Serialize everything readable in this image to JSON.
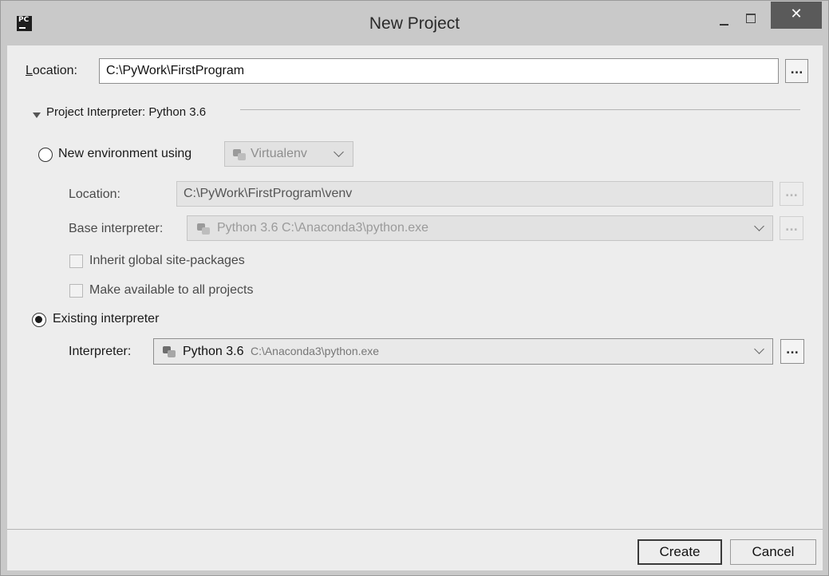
{
  "window": {
    "app_icon_text": "PC",
    "title": "New Project",
    "close_glyph": "✕",
    "colors": {
      "titlebar": "#c9c9c9",
      "client": "#ededed",
      "close": "#5a5a5a"
    }
  },
  "location": {
    "label": "Location:",
    "label_mnemonic": "L",
    "label_rest": "ocation:",
    "value": "C:\\PyWork\\FirstProgram",
    "browse": "..."
  },
  "interpreter_section": {
    "title": "Project Interpreter: Python 3.6"
  },
  "new_env": {
    "option_label": "New environment using",
    "tool": "Virtualenv",
    "location_label": "Location:",
    "location_value": "C:\\PyWork\\FirstProgram\\venv",
    "base_label": "Base interpreter:",
    "base_value": "Python 3.6 C:\\Anaconda3\\python.exe",
    "inherit_label": "Inherit global site-packages",
    "available_label": "Make available to all projects",
    "browse": "..."
  },
  "existing": {
    "option_label": "Existing interpreter",
    "interpreter_label": "Interpreter:",
    "interpreter_name": "Python 3.6",
    "interpreter_path": "C:\\Anaconda3\\python.exe",
    "browse": "..."
  },
  "footer": {
    "create": "Create",
    "cancel": "Cancel"
  }
}
